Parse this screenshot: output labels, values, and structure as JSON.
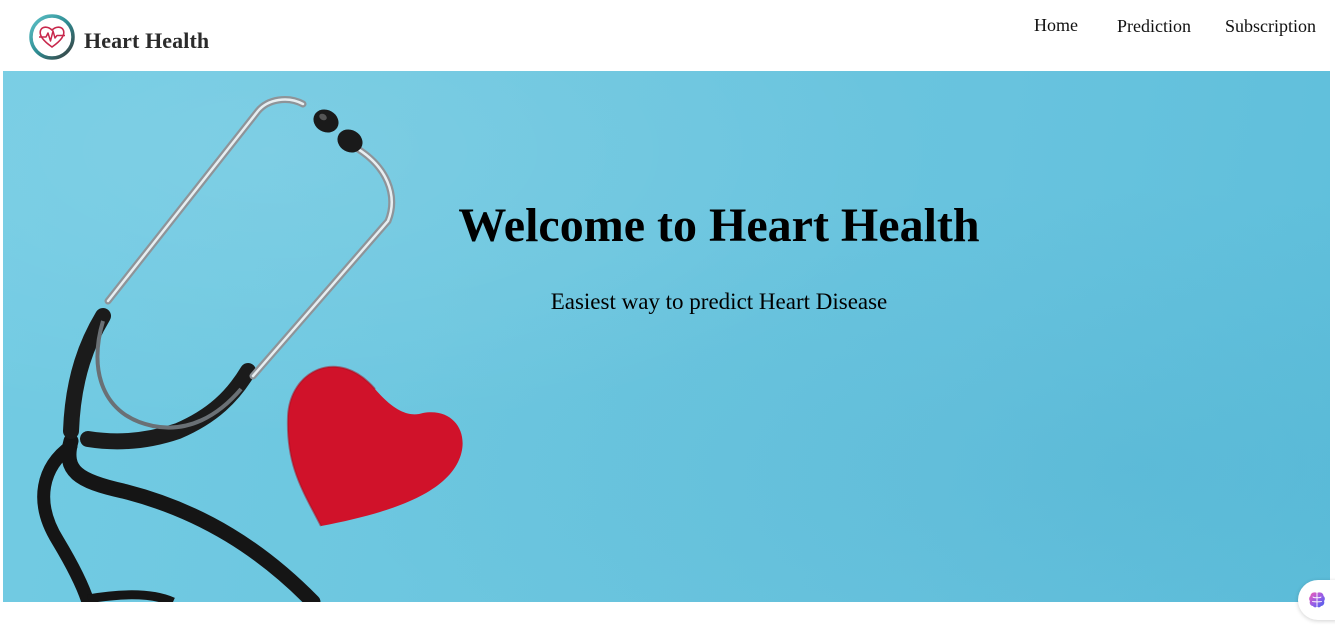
{
  "brand": {
    "name": "Heart Health",
    "logo_icon": "heart-pulse-logo-icon"
  },
  "nav": {
    "items": [
      {
        "label": "Home"
      },
      {
        "label": "Prediction"
      },
      {
        "label": "Subscription"
      }
    ]
  },
  "hero": {
    "title": "Welcome to Heart Health",
    "subtitle": "Easiest way to predict Heart Disease",
    "image_subject": "stethoscope-and-paper-heart-image",
    "background_color": "#6cc6df",
    "heart_color": "#d0122a"
  },
  "floating_button": {
    "icon": "brain-icon"
  }
}
